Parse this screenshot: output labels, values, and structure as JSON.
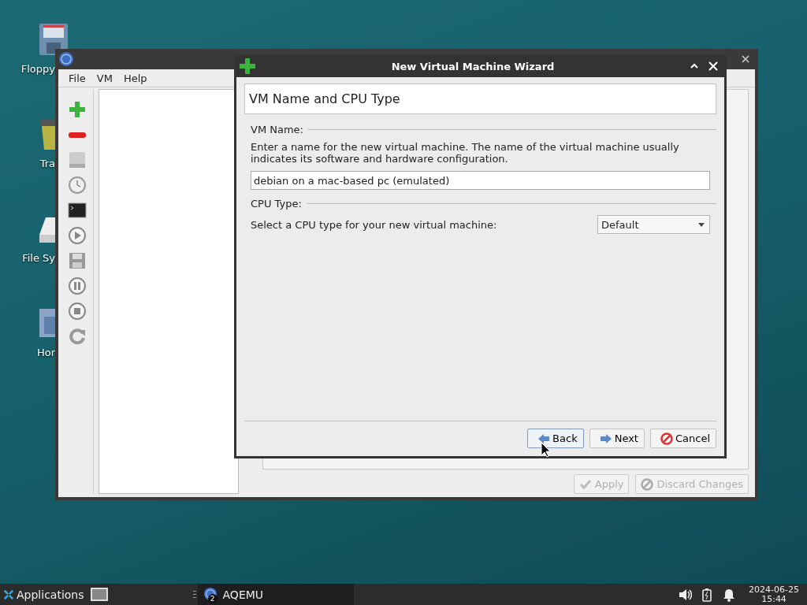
{
  "desktop": {
    "icons": [
      {
        "kind": "floppy",
        "label": "Floppy"
      },
      {
        "kind": "trash",
        "label": "Tra"
      },
      {
        "kind": "drive",
        "label": "File Sy"
      },
      {
        "kind": "home",
        "label": "Hor"
      }
    ]
  },
  "main_window": {
    "menu": [
      {
        "label": "File"
      },
      {
        "label": "VM"
      },
      {
        "label": "Help"
      }
    ],
    "buttons": [
      {
        "kind": "apply",
        "label": "Apply",
        "disabled": true
      },
      {
        "kind": "discard",
        "label": "Discard Changes",
        "disabled": true
      }
    ]
  },
  "dialog": {
    "title": "New Virtual Machine Wizard",
    "page_title": "VM Name and CPU Type",
    "name_section": {
      "heading": "VM Name:",
      "description": "Enter a name for the new virtual machine. The name of the virtual machine usually indicates its software and hardware configuration.",
      "value": "debian on a mac-based pc (emulated)"
    },
    "cpu_section": {
      "heading": "CPU Type:",
      "label": "Select a CPU type for your new virtual machine:",
      "value": "Default"
    },
    "buttons": [
      {
        "kind": "back",
        "label": "Back",
        "focused": true
      },
      {
        "kind": "next",
        "label": "Next",
        "focused": false
      },
      {
        "kind": "cancel",
        "label": "Cancel",
        "focused": false
      }
    ]
  },
  "taskbar": {
    "menu_label": "Applications",
    "task": {
      "label": "AQEMU",
      "badge": "2"
    },
    "clock": {
      "date": "2024-06-25",
      "time": "15:44"
    }
  }
}
